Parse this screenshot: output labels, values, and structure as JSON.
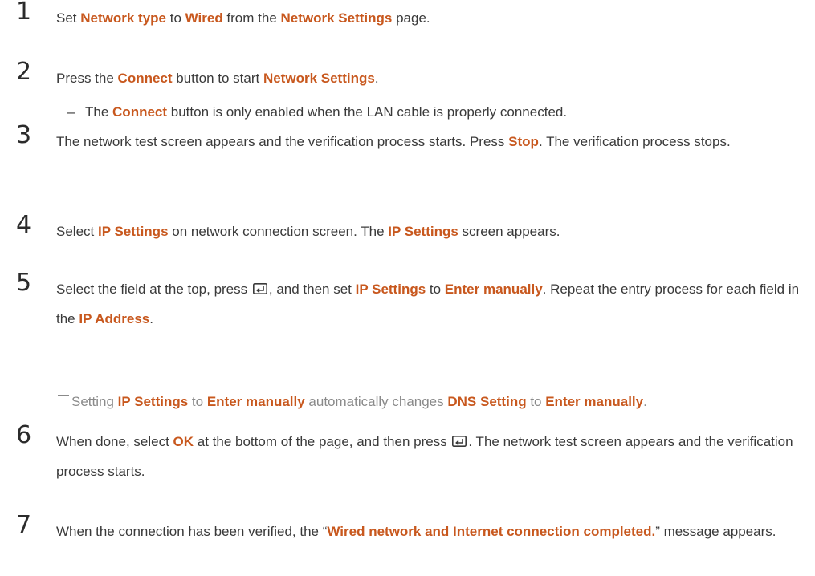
{
  "steps": [
    {
      "number": "1",
      "parts": [
        "Set ",
        "Network type",
        " to ",
        "Wired",
        " from the ",
        "Network Settings",
        " page."
      ]
    },
    {
      "number": "2",
      "parts": [
        "Press the ",
        "Connect",
        " button to start ",
        "Network Settings",
        "."
      ]
    },
    {
      "number": "3",
      "parts": [
        "The network test screen appears and the verification process starts. Press ",
        "Stop",
        ". The verification process stops."
      ]
    },
    {
      "number": "4",
      "parts": [
        "Select ",
        "IP Settings",
        " on network connection screen. The ",
        "IP Settings",
        " screen appears."
      ]
    },
    {
      "number": "5",
      "parts": [
        "Select the field at the top, press ",
        ", and then set ",
        "IP Settings",
        " to ",
        "Enter manually",
        ". Repeat the entry process for each field in the ",
        "IP Address",
        "."
      ]
    },
    {
      "number": "6",
      "parts": [
        "When done, select ",
        "OK",
        " at the bottom of the page, and then press ",
        ". The network test screen appears and the verification process starts."
      ]
    },
    {
      "number": "7",
      "parts": [
        "When the connection has been verified, the “",
        "Wired network and Internet connection completed.",
        "” message appears."
      ]
    }
  ],
  "note_step2": {
    "dash": "–",
    "parts": [
      "The ",
      "Connect",
      " button is only enabled when the LAN cable is properly connected."
    ]
  },
  "note_step5": {
    "parts": [
      "Setting ",
      "IP Settings",
      " to ",
      "Enter manually",
      " automatically changes ",
      "DNS Setting",
      " to ",
      "Enter manually",
      "."
    ]
  },
  "icons": {
    "enter": "enter-key-icon"
  },
  "colors": {
    "highlight": "#c8581e",
    "text": "#3a3a3a",
    "note": "#8a8a8a"
  }
}
